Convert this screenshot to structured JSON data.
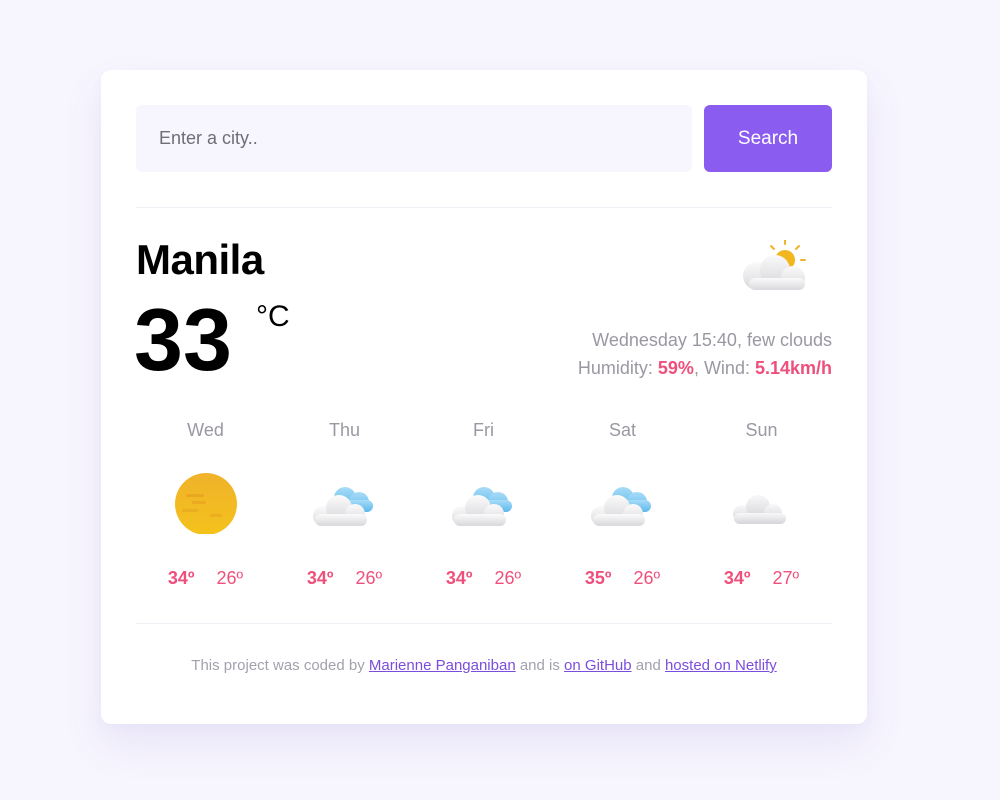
{
  "search": {
    "placeholder": "Enter a city..",
    "button_label": "Search"
  },
  "current": {
    "city": "Manila",
    "temperature": "33",
    "unit": "°C",
    "description": "Wednesday 15:40, few clouds",
    "humidity_label": "Humidity: ",
    "humidity_value": "59%",
    "wind_label": ", Wind: ",
    "wind_value": "5.14km/h",
    "icon": "sun-behind-cloud-icon"
  },
  "forecast": [
    {
      "day": "Wed",
      "high": "34º",
      "low": "26º",
      "icon": "sun-icon"
    },
    {
      "day": "Thu",
      "high": "34º",
      "low": "26º",
      "icon": "scattered-clouds-icon"
    },
    {
      "day": "Fri",
      "high": "34º",
      "low": "26º",
      "icon": "scattered-clouds-icon"
    },
    {
      "day": "Sat",
      "high": "35º",
      "low": "26º",
      "icon": "scattered-clouds-icon"
    },
    {
      "day": "Sun",
      "high": "34º",
      "low": "27º",
      "icon": "cloud-icon"
    }
  ],
  "footer": {
    "prefix": "This project was coded by ",
    "author_link": "Marienne Panganiban",
    "middle": " and is ",
    "github_link": "on GitHub",
    "and": " and ",
    "netlify_link": "hosted on Netlify"
  },
  "colors": {
    "accent": "#ef4f7b",
    "button": "#8b5cf0",
    "link": "#7c4ddc",
    "muted": "#9a98a2"
  }
}
